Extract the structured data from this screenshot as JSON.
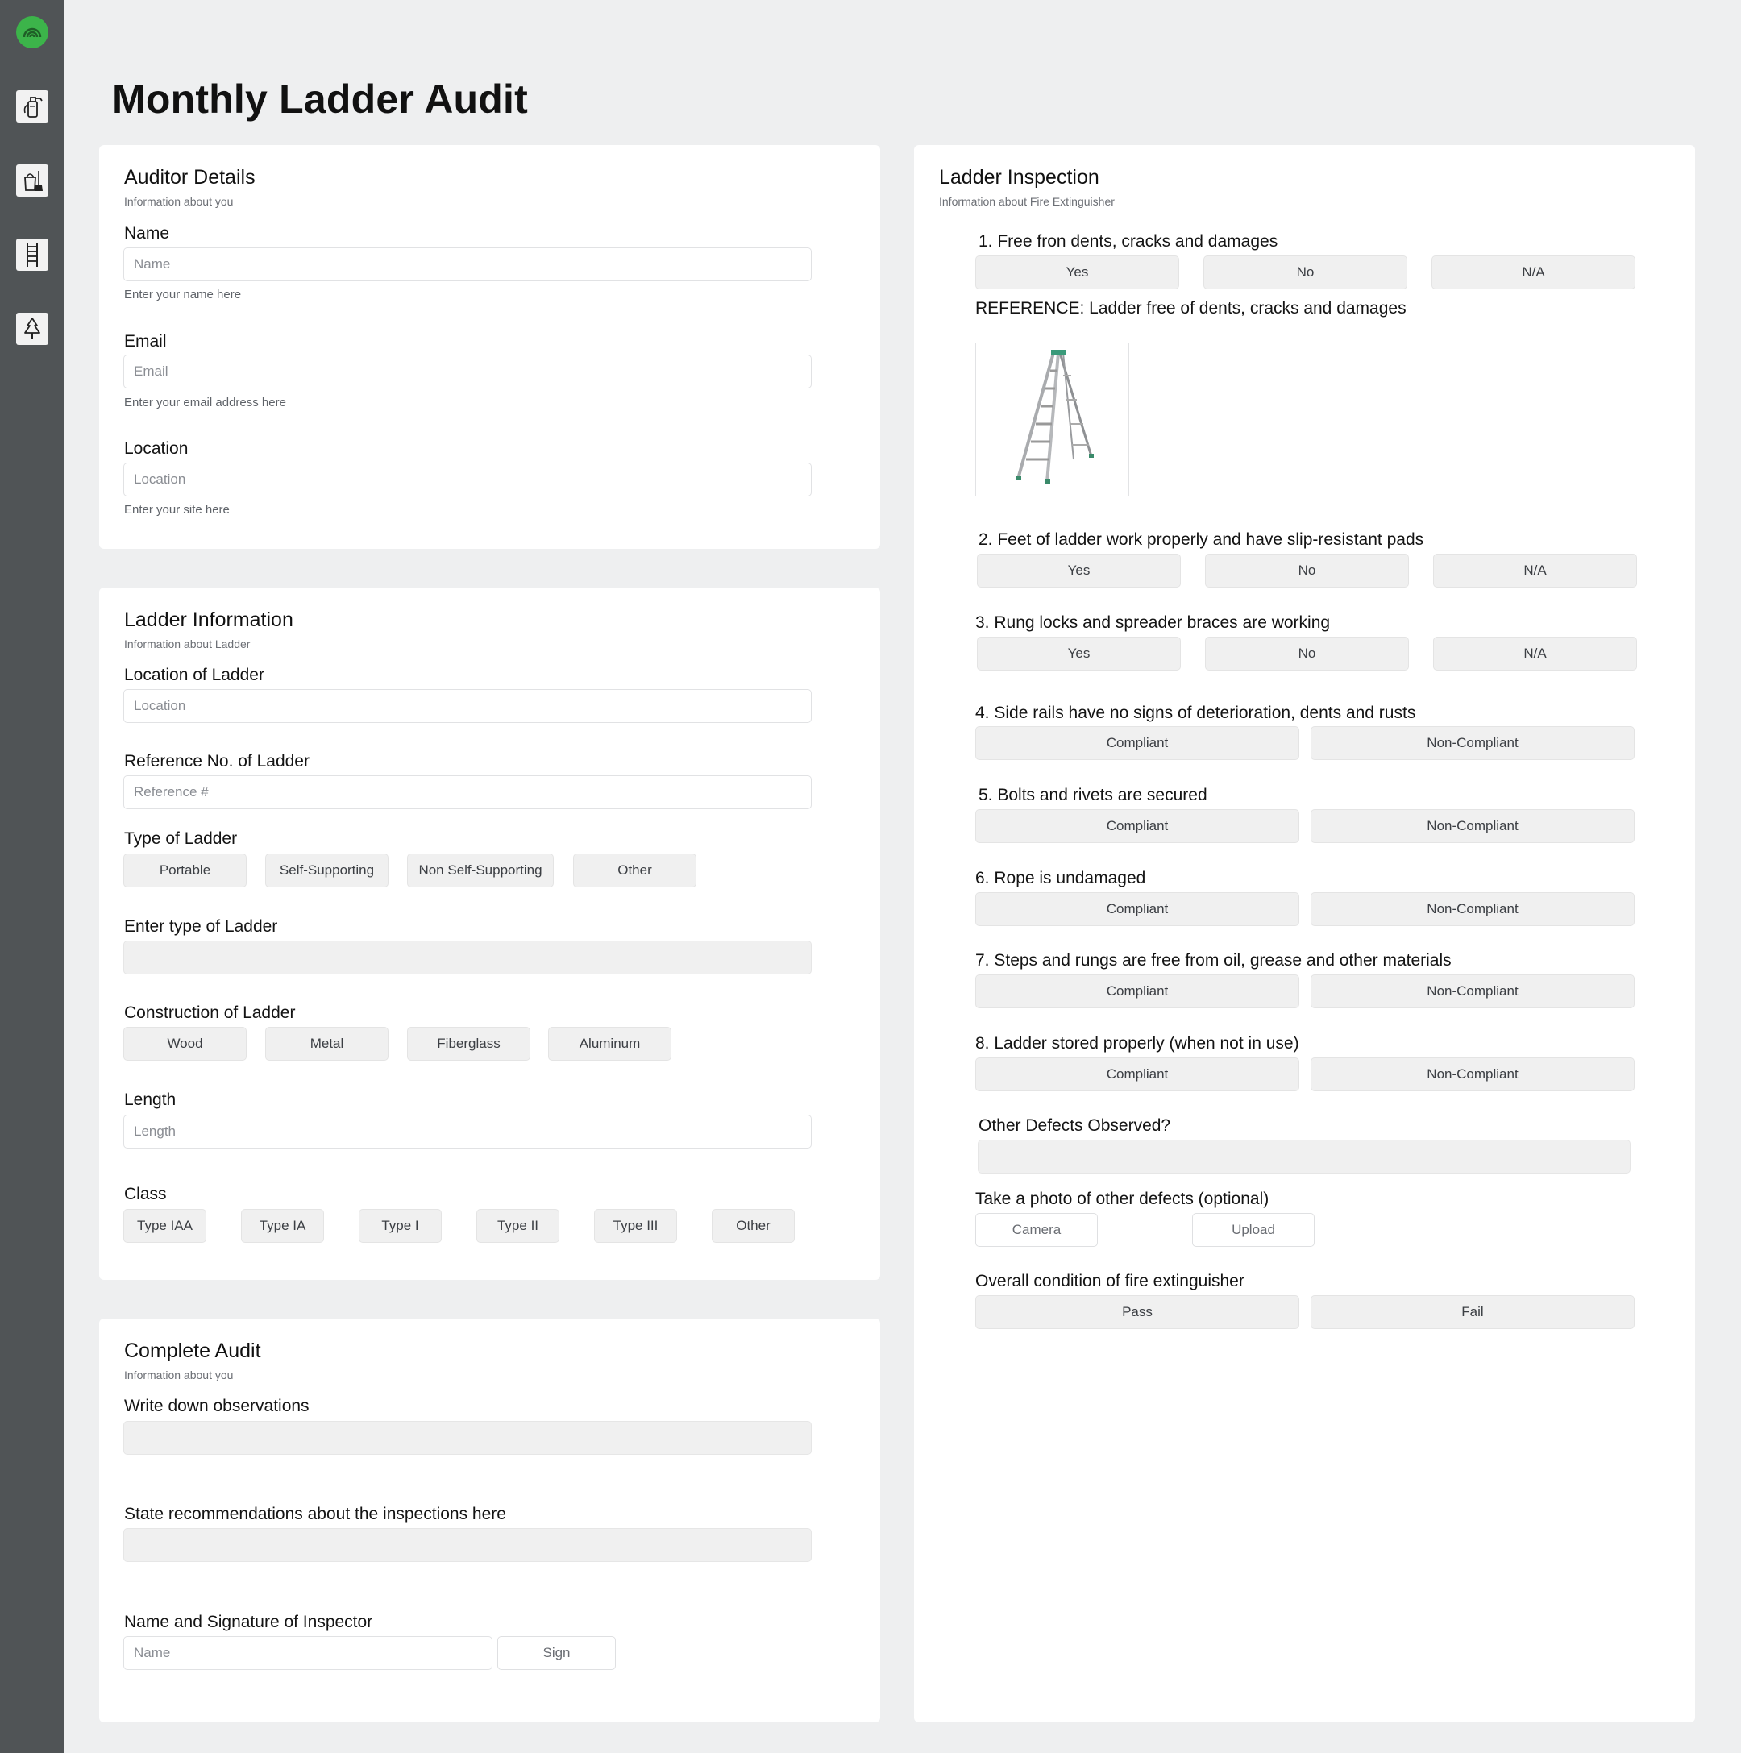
{
  "page_title": "Monthly Ladder Audit",
  "sidebar": {
    "logo": "app-logo",
    "icons": [
      "fire-extinguisher-icon",
      "cleaning-bucket-icon",
      "ladder-icon",
      "tree-icon"
    ]
  },
  "auditor": {
    "title": "Auditor Details",
    "subtitle": "Information about you",
    "name_label": "Name",
    "name_placeholder": "Name",
    "name_hint": "Enter your name here",
    "email_label": "Email",
    "email_placeholder": "Email",
    "email_hint": "Enter your email address here",
    "location_label": "Location",
    "location_placeholder": "Location",
    "location_hint": "Enter your site here"
  },
  "ladder_info": {
    "title": "Ladder Information",
    "subtitle": "Information about Ladder",
    "location_label": "Location of Ladder",
    "location_placeholder": "Location",
    "ref_label": "Reference No. of Ladder",
    "ref_placeholder": "Reference #",
    "type_label": "Type of Ladder",
    "type_options": [
      "Portable",
      "Self-Supporting",
      "Non Self-Supporting",
      "Other"
    ],
    "enter_type_label": "Enter type of Ladder",
    "construction_label": "Construction of Ladder",
    "construction_options": [
      "Wood",
      "Metal",
      "Fiberglass",
      "Aluminum"
    ],
    "length_label": "Length",
    "length_placeholder": "Length",
    "class_label": "Class",
    "class_options": [
      "Type IAA",
      "Type IA",
      "Type I",
      "Type II",
      "Type III",
      "Other"
    ]
  },
  "complete": {
    "title": "Complete Audit",
    "subtitle": "Information about you",
    "observations_label": "Write down observations",
    "recommendations_label": "State recommendations about the inspections here",
    "signature_label": "Name and Signature of Inspector",
    "name_placeholder": "Name",
    "sign_label": "Sign"
  },
  "inspection": {
    "title": "Ladder Inspection",
    "subtitle": "Information about Fire Extinguisher",
    "q1": "1. Free fron dents, cracks and damages",
    "reference": "REFERENCE: Ladder free of dents, cracks and damages",
    "q2": "2. Feet of ladder work properly and have slip-resistant pads",
    "q3": "3. Rung locks and spreader braces are working",
    "q4": "4. Side rails have no signs of deterioration, dents and rusts",
    "q5": "5. Bolts and rivets are secured",
    "q6": "6. Rope is undamaged",
    "q7": "7. Steps and rungs are free from oil, grease and other materials",
    "q8": "8. Ladder stored properly (when not in use)",
    "ynna": [
      "Yes",
      "No",
      "N/A"
    ],
    "compliance": [
      "Compliant",
      "Non-Compliant"
    ],
    "other_defects_label": "Other Defects Observed?",
    "photo_label": "Take a photo of other defects (optional)",
    "camera_label": "Camera",
    "upload_label": "Upload",
    "overall_label": "Overall condition of fire extinguisher",
    "overall_options": [
      "Pass",
      "Fail"
    ]
  }
}
